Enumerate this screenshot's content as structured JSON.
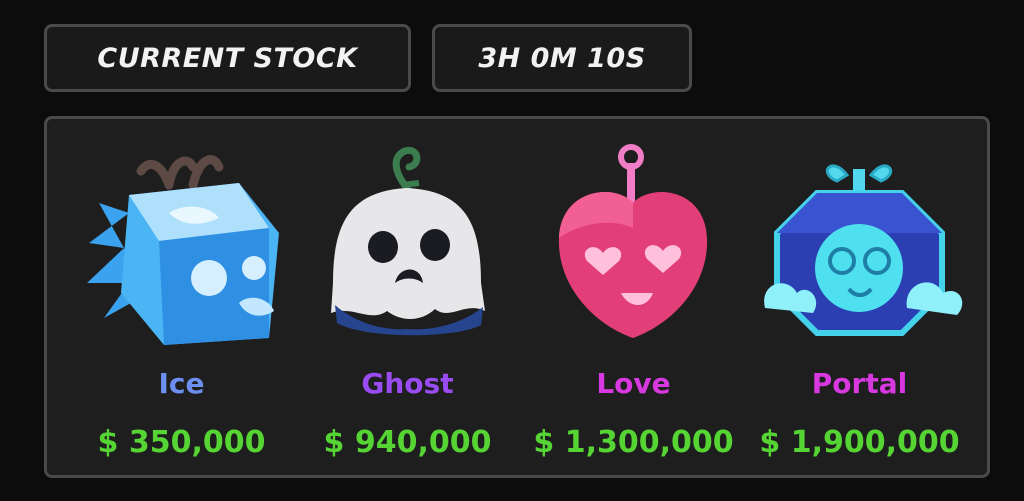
{
  "header": {
    "stock_label": "CURRENT STOCK",
    "timer": "3H 0M 10S"
  },
  "colors": {
    "price": "#55d433",
    "ice": "#6c8ff0",
    "ghost": "#9a4cf2",
    "love": "#d838e0",
    "portal": "#d838e0"
  },
  "items": [
    {
      "name": "Ice",
      "price": "$ 350,000",
      "icon": "ice-fruit-icon"
    },
    {
      "name": "Ghost",
      "price": "$ 940,000",
      "icon": "ghost-fruit-icon"
    },
    {
      "name": "Love",
      "price": "$ 1,300,000",
      "icon": "love-fruit-icon"
    },
    {
      "name": "Portal",
      "price": "$ 1,900,000",
      "icon": "portal-fruit-icon"
    }
  ]
}
